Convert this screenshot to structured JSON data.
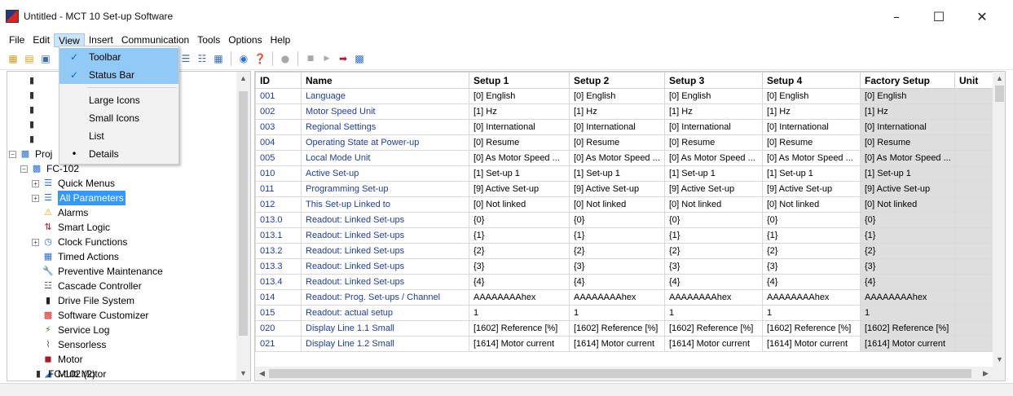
{
  "window": {
    "title": "Untitled - MCT 10 Set-up Software",
    "minimize": "–",
    "maximize": "☐",
    "close": "✕"
  },
  "menu": [
    "File",
    "Edit",
    "View",
    "Insert",
    "Communication",
    "Tools",
    "Options",
    "Help"
  ],
  "view_menu": {
    "items": [
      {
        "label": "Toolbar",
        "mark": "✓"
      },
      {
        "label": "Status Bar",
        "mark": "✓"
      },
      {
        "label": "Large Icons",
        "mark": ""
      },
      {
        "label": "Small Icons",
        "mark": ""
      },
      {
        "label": "List",
        "mark": ""
      },
      {
        "label": "Details",
        "mark": "•"
      }
    ]
  },
  "tree": {
    "partial": [
      "Proj",
      "FC-102"
    ],
    "items": [
      {
        "label": "Quick Menus",
        "icon": "list-icon"
      },
      {
        "label": "All Parameters",
        "icon": "list-icon",
        "selected": true
      },
      {
        "label": "Alarms",
        "icon": "warning-icon"
      },
      {
        "label": "Smart Logic",
        "icon": "logic-icon"
      },
      {
        "label": "Clock Functions",
        "icon": "clock-icon"
      },
      {
        "label": "Timed Actions",
        "icon": "calendar-icon"
      },
      {
        "label": "Preventive Maintenance",
        "icon": "wrench-icon"
      },
      {
        "label": "Cascade Controller",
        "icon": "cascade-icon"
      },
      {
        "label": "Drive File System",
        "icon": "drive-icon"
      },
      {
        "label": "Software Customizer",
        "icon": "customizer-icon"
      },
      {
        "label": "Service Log",
        "icon": "log-icon"
      },
      {
        "label": "Sensorless",
        "icon": "sensorless-icon"
      },
      {
        "label": "Motor",
        "icon": "motor-icon"
      },
      {
        "label": "Multi Motor",
        "icon": "multi-motor-icon"
      }
    ],
    "bottom_partial": "FC-102 (2)"
  },
  "grid": {
    "headers": [
      "ID",
      "Name",
      "Setup 1",
      "Setup 2",
      "Setup 3",
      "Setup 4",
      "Factory Setup",
      "Unit"
    ],
    "rows": [
      [
        "001",
        "Language",
        "[0] English",
        "[0] English",
        "[0] English",
        "[0] English",
        "[0] English",
        ""
      ],
      [
        "002",
        "Motor Speed Unit",
        "[1] Hz",
        "[1] Hz",
        "[1] Hz",
        "[1] Hz",
        "[1] Hz",
        ""
      ],
      [
        "003",
        "Regional Settings",
        "[0] International",
        "[0] International",
        "[0] International",
        "[0] International",
        "[0] International",
        ""
      ],
      [
        "004",
        "Operating State at Power-up",
        "[0] Resume",
        "[0] Resume",
        "[0] Resume",
        "[0] Resume",
        "[0] Resume",
        ""
      ],
      [
        "005",
        "Local Mode Unit",
        "[0] As Motor Speed ...",
        "[0] As Motor Speed ...",
        "[0] As Motor Speed ...",
        "[0] As Motor Speed ...",
        "[0] As Motor Speed ...",
        ""
      ],
      [
        "010",
        "Active Set-up",
        "[1] Set-up 1",
        "[1] Set-up 1",
        "[1] Set-up 1",
        "[1] Set-up 1",
        "[1] Set-up 1",
        ""
      ],
      [
        "011",
        "Programming Set-up",
        "[9] Active Set-up",
        "[9] Active Set-up",
        "[9] Active Set-up",
        "[9] Active Set-up",
        "[9] Active Set-up",
        ""
      ],
      [
        "012",
        "This Set-up Linked to",
        "[0] Not linked",
        "[0] Not linked",
        "[0] Not linked",
        "[0] Not linked",
        "[0] Not linked",
        ""
      ],
      [
        "013.0",
        "Readout: Linked Set-ups",
        "{0}",
        "{0}",
        "{0}",
        "{0}",
        "{0}",
        ""
      ],
      [
        "013.1",
        "Readout: Linked Set-ups",
        "{1}",
        "{1}",
        "{1}",
        "{1}",
        "{1}",
        ""
      ],
      [
        "013.2",
        "Readout: Linked Set-ups",
        "{2}",
        "{2}",
        "{2}",
        "{2}",
        "{2}",
        ""
      ],
      [
        "013.3",
        "Readout: Linked Set-ups",
        "{3}",
        "{3}",
        "{3}",
        "{3}",
        "{3}",
        ""
      ],
      [
        "013.4",
        "Readout: Linked Set-ups",
        "{4}",
        "{4}",
        "{4}",
        "{4}",
        "{4}",
        ""
      ],
      [
        "014",
        "Readout: Prog. Set-ups / Channel",
        "AAAAAAAAhex",
        "AAAAAAAAhex",
        "AAAAAAAAhex",
        "AAAAAAAAhex",
        "AAAAAAAAhex",
        ""
      ],
      [
        "015",
        "Readout: actual setup",
        "1",
        "1",
        "1",
        "1",
        "1",
        ""
      ],
      [
        "020",
        "Display Line 1.1 Small",
        "[1602] Reference [%]",
        "[1602] Reference [%]",
        "[1602] Reference [%]",
        "[1602] Reference [%]",
        "[1602] Reference [%]",
        ""
      ],
      [
        "021",
        "Display Line 1.2 Small",
        "[1614] Motor current",
        "[1614] Motor current",
        "[1614] Motor current",
        "[1614] Motor current",
        "[1614] Motor current",
        ""
      ]
    ]
  }
}
